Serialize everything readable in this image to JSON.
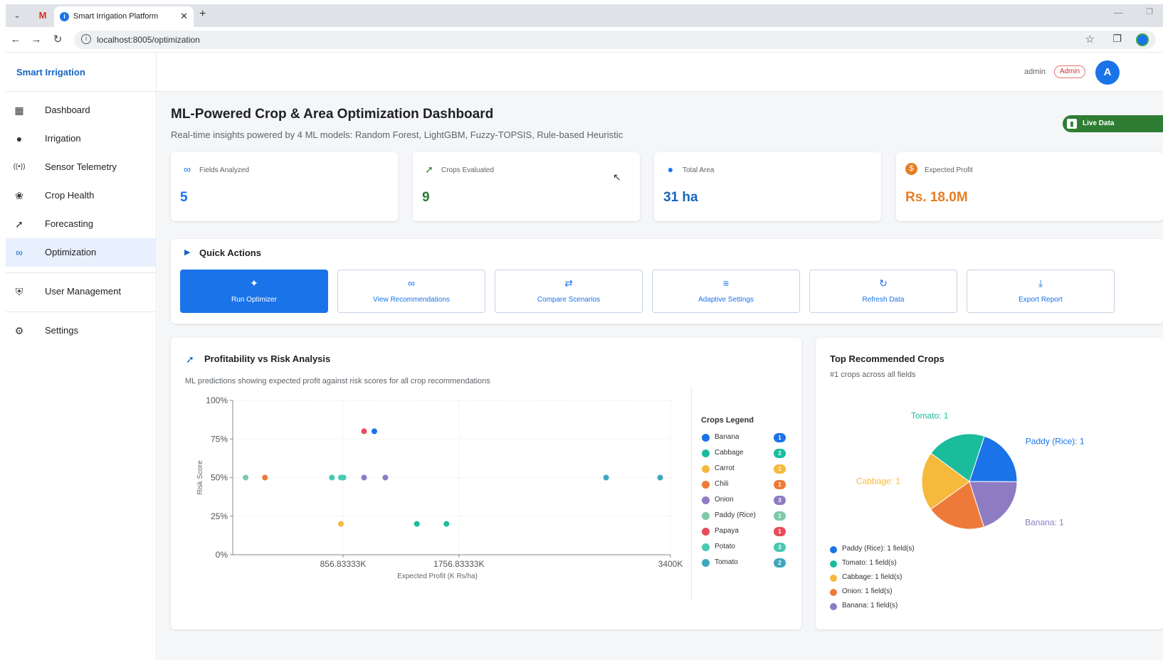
{
  "browser": {
    "gmail_label": "M",
    "tab_title": "Smart Irrigation Platform",
    "new_tab": "+",
    "url": "localhost:8005/optimization"
  },
  "sidebar": {
    "brand": "Smart Irrigation",
    "items": [
      {
        "label": "Dashboard",
        "icon": "dashboard-icon"
      },
      {
        "label": "Irrigation",
        "icon": "water-drop-icon"
      },
      {
        "label": "Sensor Telemetry",
        "icon": "sensor-icon"
      },
      {
        "label": "Crop Health",
        "icon": "plant-icon"
      },
      {
        "label": "Forecasting",
        "icon": "trend-icon"
      },
      {
        "label": "Optimization",
        "icon": "bike-icon",
        "active": true
      }
    ],
    "admin_items": [
      {
        "label": "User Management",
        "icon": "user-shield-icon"
      },
      {
        "label": "Settings",
        "icon": "gear-icon"
      }
    ]
  },
  "header": {
    "user": "admin",
    "role_badge": "Admin",
    "avatar_initial": "A"
  },
  "page": {
    "title": "ML-Powered Crop & Area Optimization Dashboard",
    "subtitle": "Real-time insights powered by 4 ML models: Random Forest, LightGBM, Fuzzy-TOPSIS, Rule-based Heuristic",
    "live_label": "Live Data"
  },
  "kpis": [
    {
      "label": "Fields Analyzed",
      "value": "5",
      "icon": "bike-icon",
      "color": "#1a73e8"
    },
    {
      "label": "Crops Evaluated",
      "value": "9",
      "icon": "trend-icon",
      "color": "#2e7d32"
    },
    {
      "label": "Total Area",
      "value": "31 ha",
      "icon": "water-drop-icon",
      "color": "#1a73e8"
    },
    {
      "label": "Expected Profit",
      "value": "Rs. 18.0M",
      "icon": "money-icon",
      "color": "#e67e22"
    }
  ],
  "quick_actions": {
    "title": "Quick Actions",
    "buttons": [
      {
        "label": "Run Optimizer",
        "icon": "magic-icon",
        "primary": true
      },
      {
        "label": "View Recommendations",
        "icon": "bike-icon"
      },
      {
        "label": "Compare Scenarios",
        "icon": "compare-icon"
      },
      {
        "label": "Adaptive Settings",
        "icon": "sliders-icon"
      },
      {
        "label": "Refresh Data",
        "icon": "refresh-icon"
      },
      {
        "label": "Export Report",
        "icon": "download-icon"
      }
    ]
  },
  "scatter": {
    "title": "Profitability vs Risk Analysis",
    "subtitle": "ML predictions showing expected profit against risk scores for all crop recommendations",
    "legend_title": "Crops Legend"
  },
  "chart_data": [
    {
      "type": "scatter",
      "title": "Profitability vs Risk Analysis",
      "xlabel": "Expected Profit (K Rs/ha)",
      "ylabel": "Risk Score",
      "xlim": [
        0,
        3400
      ],
      "ylim": [
        0,
        100
      ],
      "x_ticks": [
        "856.83333K",
        "1756.83333K",
        "3400K"
      ],
      "x_tick_values": [
        856.83333,
        1756.83333,
        3400
      ],
      "y_ticks": [
        "0%",
        "25%",
        "50%",
        "75%",
        "100%"
      ],
      "y_tick_values": [
        0,
        25,
        50,
        75,
        100
      ],
      "series": [
        {
          "name": "Banana",
          "color": "#1a73e8",
          "count": 1,
          "points": [
            [
              1100,
              80
            ]
          ]
        },
        {
          "name": "Cabbage",
          "color": "#1abc9c",
          "count": 2,
          "points": [
            [
              1430,
              20
            ],
            [
              1660,
              20
            ]
          ]
        },
        {
          "name": "Carrot",
          "color": "#f6b93b",
          "count": 1,
          "points": [
            [
              840,
              20
            ]
          ]
        },
        {
          "name": "Chili",
          "color": "#ee7a3a",
          "count": 1,
          "points": [
            [
              250,
              50
            ]
          ]
        },
        {
          "name": "Onion",
          "color": "#8e7cc3",
          "count": 3,
          "points": [
            [
              1020,
              50
            ],
            [
              1185,
              50
            ]
          ]
        },
        {
          "name": "Paddy (Rice)",
          "color": "#7fc8a9",
          "count": 1,
          "points": [
            [
              100,
              50
            ]
          ]
        },
        {
          "name": "Papaya",
          "color": "#e74c5b",
          "count": 1,
          "points": [
            [
              1020,
              80
            ]
          ]
        },
        {
          "name": "Potato",
          "color": "#48c9b0",
          "count": 3,
          "points": [
            [
              770,
              50
            ],
            [
              840,
              50
            ],
            [
              860,
              50
            ]
          ]
        },
        {
          "name": "Tomato",
          "color": "#3fa7c0",
          "count": 2,
          "points": [
            [
              2900,
              50
            ],
            [
              3320,
              50
            ]
          ]
        }
      ],
      "legend": "right"
    },
    {
      "type": "pie",
      "title": "Top Recommended Crops",
      "subtitle": "#1 crops across all fields",
      "slices": [
        {
          "label": "Paddy (Rice)",
          "value": 1,
          "color": "#1a73e8",
          "callout": "Paddy (Rice): 1",
          "legend": "Paddy (Rice): 1 field(s)"
        },
        {
          "label": "Banana",
          "value": 1,
          "color": "#8e7cc3",
          "callout": "Banana: 1",
          "legend": "Banana: 1 field(s)"
        },
        {
          "label": "Onion",
          "value": 1,
          "color": "#ee7a3a",
          "callout": "Onion: 1",
          "legend": "Onion: 1 field(s)"
        },
        {
          "label": "Cabbage",
          "value": 1,
          "color": "#f6b93b",
          "callout": "Cabbage: 1",
          "legend": "Cabbage: 1 field(s)"
        },
        {
          "label": "Tomato",
          "value": 1,
          "color": "#1abc9c",
          "callout": "Tomato: 1",
          "legend": "Tomato: 1 field(s)"
        }
      ],
      "legend_order": [
        "Paddy (Rice)",
        "Tomato",
        "Cabbage",
        "Onion",
        "Banana"
      ]
    }
  ]
}
